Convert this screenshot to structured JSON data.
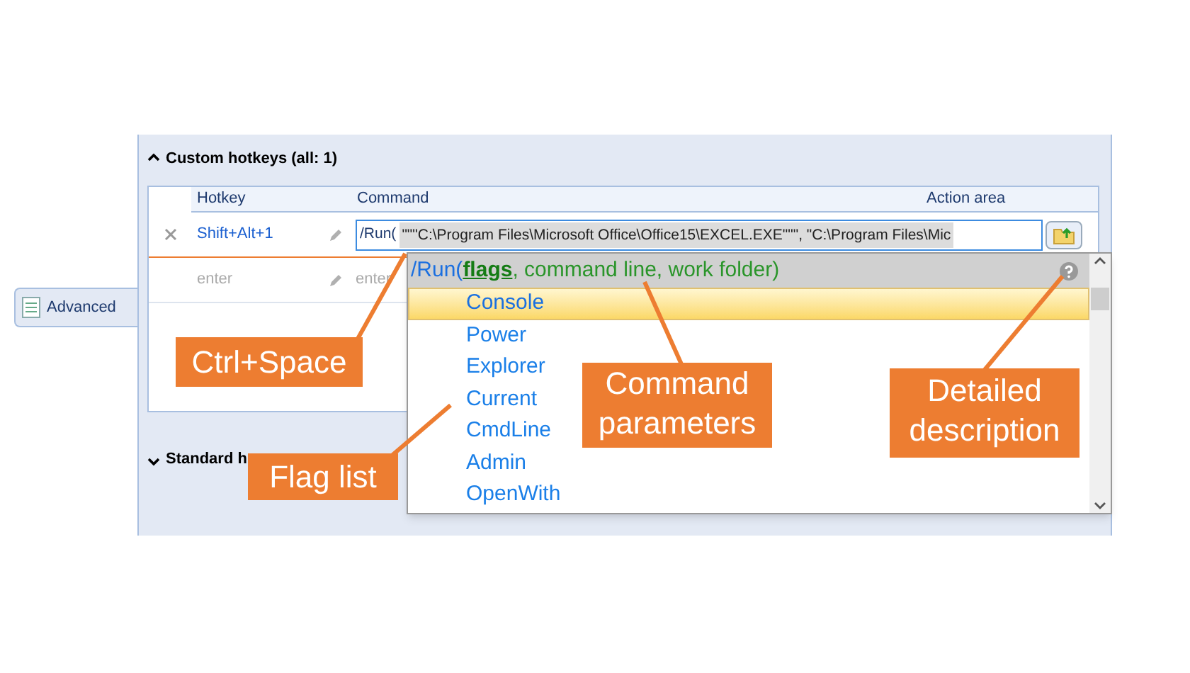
{
  "sidebar": {
    "items": [
      {
        "label": "Advanced",
        "selected": true
      }
    ]
  },
  "custom_section": {
    "title": "Custom hotkeys (all: 1)",
    "expanded": true
  },
  "table": {
    "columns": [
      "Hotkey",
      "Command",
      "Action area"
    ],
    "rows": [
      {
        "hotkey": "Shift+Alt+1",
        "command": "/Run(",
        "command_rest": "\"\"\"C:\\Program Files\\Microsoft Office\\Office15\\EXCEL.EXE\"\"\", \"C:\\Program Files\\Mic",
        "placeholder": false
      },
      {
        "hotkey": "enter",
        "command": "enter",
        "placeholder": true
      }
    ]
  },
  "standard_section": {
    "title": "Standard h",
    "expanded": false
  },
  "popup": {
    "function": "/Run(",
    "active_param": "flags",
    "rest": ", command line, work folder)",
    "items": [
      {
        "label": "Console",
        "selected": true
      },
      {
        "label": "Power",
        "selected": false
      },
      {
        "label": "Explorer",
        "selected": false
      },
      {
        "label": "Current",
        "selected": false
      },
      {
        "label": "CmdLine",
        "selected": false
      },
      {
        "label": "Admin",
        "selected": false
      },
      {
        "label": "OpenWith",
        "selected": false
      }
    ]
  },
  "callouts": [
    {
      "text": "Ctrl+Space"
    },
    {
      "text": "Command parameters"
    },
    {
      "text": "Detailed description"
    },
    {
      "text": "Flag list"
    }
  ]
}
